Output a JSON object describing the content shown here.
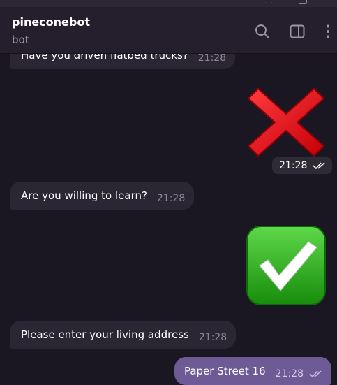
{
  "header": {
    "title": "pineconebot",
    "status": "bot"
  },
  "messages": [
    {
      "text": "Have you driven flatbed trucks?",
      "time": "21:28"
    },
    {
      "sticker_time": "21:28"
    },
    {
      "text": "Are you willing to learn?",
      "time": "21:28"
    },
    {
      "text": "Please enter your living address",
      "time": "21:28"
    },
    {
      "text": "Paper Street 16",
      "time": "21:28"
    }
  ],
  "icons": {
    "search": "search-icon",
    "sidebar": "sidebar-toggle-icon",
    "menu": "more-vertical-icon",
    "no_sticker": "red-cross-mark",
    "yes_sticker": "green-check-mark",
    "read_status": "double-check-icon"
  },
  "colors": {
    "background": "#1b1722",
    "header": "#251f2d",
    "incoming_bubble": "#2b2633",
    "outgoing_bubble": "#6e5b96",
    "cross": "#e8101a",
    "check_box": "#2da51a"
  }
}
